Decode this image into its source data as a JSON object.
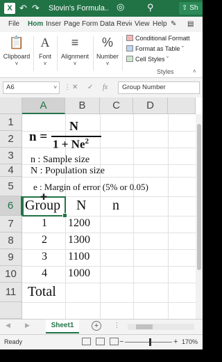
{
  "titlebar": {
    "title": "Slovin's Formula...",
    "share_label": "Sh",
    "undo_icon": "undo-icon",
    "redo_icon": "redo-icon",
    "lightbulb_icon": "lightbulb-icon",
    "search_icon": "search-icon",
    "accent": "#217346"
  },
  "tabs": [
    "File",
    "Hom",
    "Inser",
    "Page",
    "Form",
    "Data",
    "Revie",
    "View",
    "Help"
  ],
  "active_tab": "Hom",
  "ribbon": {
    "clipboard_label": "Clipboard",
    "font_label": "Font",
    "alignment_label": "Alignment",
    "number_label": "Number",
    "conditional_formatting": "Conditional Formatt",
    "format_as_table": "Format as Table ˇ",
    "cell_styles": "Cell Styles ˇ",
    "styles_caption": "Styles"
  },
  "formula_bar": {
    "name_box": "A6",
    "formula": "Group Number",
    "fx_label": "fx"
  },
  "columns": [
    "A",
    "B",
    "C",
    "D"
  ],
  "selected_column": "A",
  "rows": [
    "1",
    "2",
    "3",
    "4",
    "5",
    "6",
    "7",
    "8",
    "9",
    "10",
    "11"
  ],
  "selected_row": "6",
  "formula_image": {
    "lhs": "n =",
    "numerator": "N",
    "denominator": "1 + Ne",
    "exponent": "2"
  },
  "cells": {
    "a3": "n : Sample size",
    "a4": "N : Population size",
    "a5": "e : Margin of error (5% or 0.05)",
    "a6": "Group",
    "b6": "N",
    "c6": "n",
    "a7": "1",
    "b7": "1200",
    "a8": "2",
    "b8": "1300",
    "a9": "3",
    "b9": "1100",
    "a10": "4",
    "b10": "1000",
    "a11": "Total"
  },
  "sheet_tabs": {
    "active": "Sheet1",
    "add_icon": "plus-icon"
  },
  "status": {
    "ready": "Ready",
    "zoom": "170%"
  }
}
